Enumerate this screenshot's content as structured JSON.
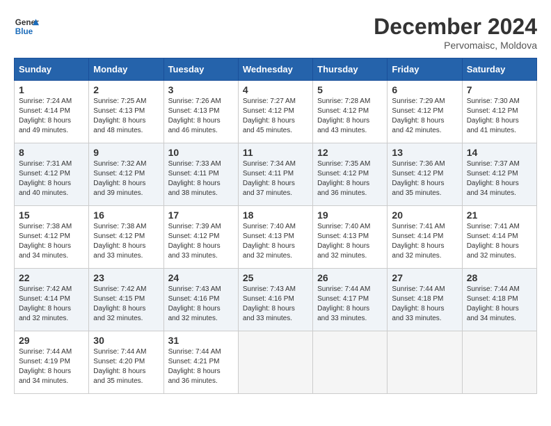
{
  "header": {
    "logo_line1": "General",
    "logo_line2": "Blue",
    "month": "December 2024",
    "location": "Pervomaisc, Moldova"
  },
  "weekdays": [
    "Sunday",
    "Monday",
    "Tuesday",
    "Wednesday",
    "Thursday",
    "Friday",
    "Saturday"
  ],
  "weeks": [
    [
      {
        "day": "1",
        "sunrise": "Sunrise: 7:24 AM",
        "sunset": "Sunset: 4:14 PM",
        "daylight": "Daylight: 8 hours and 49 minutes."
      },
      {
        "day": "2",
        "sunrise": "Sunrise: 7:25 AM",
        "sunset": "Sunset: 4:13 PM",
        "daylight": "Daylight: 8 hours and 48 minutes."
      },
      {
        "day": "3",
        "sunrise": "Sunrise: 7:26 AM",
        "sunset": "Sunset: 4:13 PM",
        "daylight": "Daylight: 8 hours and 46 minutes."
      },
      {
        "day": "4",
        "sunrise": "Sunrise: 7:27 AM",
        "sunset": "Sunset: 4:12 PM",
        "daylight": "Daylight: 8 hours and 45 minutes."
      },
      {
        "day": "5",
        "sunrise": "Sunrise: 7:28 AM",
        "sunset": "Sunset: 4:12 PM",
        "daylight": "Daylight: 8 hours and 43 minutes."
      },
      {
        "day": "6",
        "sunrise": "Sunrise: 7:29 AM",
        "sunset": "Sunset: 4:12 PM",
        "daylight": "Daylight: 8 hours and 42 minutes."
      },
      {
        "day": "7",
        "sunrise": "Sunrise: 7:30 AM",
        "sunset": "Sunset: 4:12 PM",
        "daylight": "Daylight: 8 hours and 41 minutes."
      }
    ],
    [
      {
        "day": "8",
        "sunrise": "Sunrise: 7:31 AM",
        "sunset": "Sunset: 4:12 PM",
        "daylight": "Daylight: 8 hours and 40 minutes."
      },
      {
        "day": "9",
        "sunrise": "Sunrise: 7:32 AM",
        "sunset": "Sunset: 4:12 PM",
        "daylight": "Daylight: 8 hours and 39 minutes."
      },
      {
        "day": "10",
        "sunrise": "Sunrise: 7:33 AM",
        "sunset": "Sunset: 4:11 PM",
        "daylight": "Daylight: 8 hours and 38 minutes."
      },
      {
        "day": "11",
        "sunrise": "Sunrise: 7:34 AM",
        "sunset": "Sunset: 4:11 PM",
        "daylight": "Daylight: 8 hours and 37 minutes."
      },
      {
        "day": "12",
        "sunrise": "Sunrise: 7:35 AM",
        "sunset": "Sunset: 4:12 PM",
        "daylight": "Daylight: 8 hours and 36 minutes."
      },
      {
        "day": "13",
        "sunrise": "Sunrise: 7:36 AM",
        "sunset": "Sunset: 4:12 PM",
        "daylight": "Daylight: 8 hours and 35 minutes."
      },
      {
        "day": "14",
        "sunrise": "Sunrise: 7:37 AM",
        "sunset": "Sunset: 4:12 PM",
        "daylight": "Daylight: 8 hours and 34 minutes."
      }
    ],
    [
      {
        "day": "15",
        "sunrise": "Sunrise: 7:38 AM",
        "sunset": "Sunset: 4:12 PM",
        "daylight": "Daylight: 8 hours and 34 minutes."
      },
      {
        "day": "16",
        "sunrise": "Sunrise: 7:38 AM",
        "sunset": "Sunset: 4:12 PM",
        "daylight": "Daylight: 8 hours and 33 minutes."
      },
      {
        "day": "17",
        "sunrise": "Sunrise: 7:39 AM",
        "sunset": "Sunset: 4:12 PM",
        "daylight": "Daylight: 8 hours and 33 minutes."
      },
      {
        "day": "18",
        "sunrise": "Sunrise: 7:40 AM",
        "sunset": "Sunset: 4:13 PM",
        "daylight": "Daylight: 8 hours and 32 minutes."
      },
      {
        "day": "19",
        "sunrise": "Sunrise: 7:40 AM",
        "sunset": "Sunset: 4:13 PM",
        "daylight": "Daylight: 8 hours and 32 minutes."
      },
      {
        "day": "20",
        "sunrise": "Sunrise: 7:41 AM",
        "sunset": "Sunset: 4:14 PM",
        "daylight": "Daylight: 8 hours and 32 minutes."
      },
      {
        "day": "21",
        "sunrise": "Sunrise: 7:41 AM",
        "sunset": "Sunset: 4:14 PM",
        "daylight": "Daylight: 8 hours and 32 minutes."
      }
    ],
    [
      {
        "day": "22",
        "sunrise": "Sunrise: 7:42 AM",
        "sunset": "Sunset: 4:14 PM",
        "daylight": "Daylight: 8 hours and 32 minutes."
      },
      {
        "day": "23",
        "sunrise": "Sunrise: 7:42 AM",
        "sunset": "Sunset: 4:15 PM",
        "daylight": "Daylight: 8 hours and 32 minutes."
      },
      {
        "day": "24",
        "sunrise": "Sunrise: 7:43 AM",
        "sunset": "Sunset: 4:16 PM",
        "daylight": "Daylight: 8 hours and 32 minutes."
      },
      {
        "day": "25",
        "sunrise": "Sunrise: 7:43 AM",
        "sunset": "Sunset: 4:16 PM",
        "daylight": "Daylight: 8 hours and 33 minutes."
      },
      {
        "day": "26",
        "sunrise": "Sunrise: 7:44 AM",
        "sunset": "Sunset: 4:17 PM",
        "daylight": "Daylight: 8 hours and 33 minutes."
      },
      {
        "day": "27",
        "sunrise": "Sunrise: 7:44 AM",
        "sunset": "Sunset: 4:18 PM",
        "daylight": "Daylight: 8 hours and 33 minutes."
      },
      {
        "day": "28",
        "sunrise": "Sunrise: 7:44 AM",
        "sunset": "Sunset: 4:18 PM",
        "daylight": "Daylight: 8 hours and 34 minutes."
      }
    ],
    [
      {
        "day": "29",
        "sunrise": "Sunrise: 7:44 AM",
        "sunset": "Sunset: 4:19 PM",
        "daylight": "Daylight: 8 hours and 34 minutes."
      },
      {
        "day": "30",
        "sunrise": "Sunrise: 7:44 AM",
        "sunset": "Sunset: 4:20 PM",
        "daylight": "Daylight: 8 hours and 35 minutes."
      },
      {
        "day": "31",
        "sunrise": "Sunrise: 7:44 AM",
        "sunset": "Sunset: 4:21 PM",
        "daylight": "Daylight: 8 hours and 36 minutes."
      },
      null,
      null,
      null,
      null
    ]
  ]
}
